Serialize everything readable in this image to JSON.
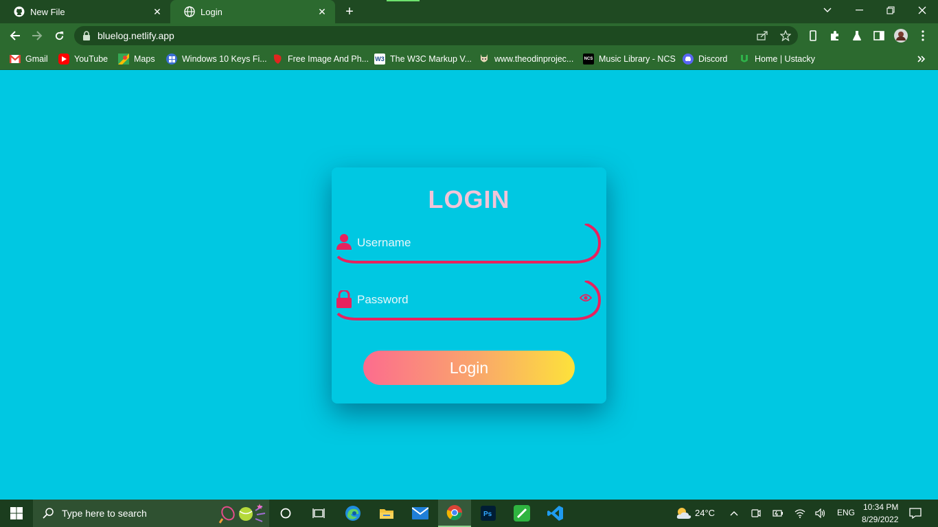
{
  "browser": {
    "tabs": [
      {
        "title": "New File",
        "active": false,
        "icon": "github-icon"
      },
      {
        "title": "Login",
        "active": true,
        "icon": "globe-icon"
      }
    ],
    "url": "bluelog.netlify.app",
    "bookmarks": [
      {
        "label": "Gmail",
        "icon": "gmail-icon"
      },
      {
        "label": "YouTube",
        "icon": "youtube-icon"
      },
      {
        "label": "Maps",
        "icon": "maps-icon"
      },
      {
        "label": "Windows 10 Keys Fi...",
        "icon": "windows-keys-icon"
      },
      {
        "label": "Free Image And Ph...",
        "icon": "free-image-icon"
      },
      {
        "label": "The W3C Markup V...",
        "icon": "w3c-icon"
      },
      {
        "label": "www.theodinprojec...",
        "icon": "odin-icon"
      },
      {
        "label": "Music Library - NCS",
        "icon": "ncs-icon"
      },
      {
        "label": "Discord",
        "icon": "discord-icon"
      },
      {
        "label": "Home | Ustacky",
        "icon": "ustacky-icon"
      }
    ],
    "ncs_badge": "NCS",
    "w3c_badge": "W3"
  },
  "login": {
    "title": "LOGIN",
    "username_placeholder": "Username",
    "password_placeholder": "Password",
    "button_label": "Login"
  },
  "taskbar": {
    "search_placeholder": "Type here to search",
    "weather": "24°C",
    "language": "ENG",
    "time": "10:34 PM",
    "date": "8/29/2022"
  },
  "colors": {
    "page_bg": "#00c8e2",
    "accent_pink": "#e8215e",
    "title_pink": "#f2c4d8",
    "button_gradient_start": "#fc6c8e",
    "button_gradient_end": "#fde23a",
    "chrome_green": "#2c6a2f"
  }
}
